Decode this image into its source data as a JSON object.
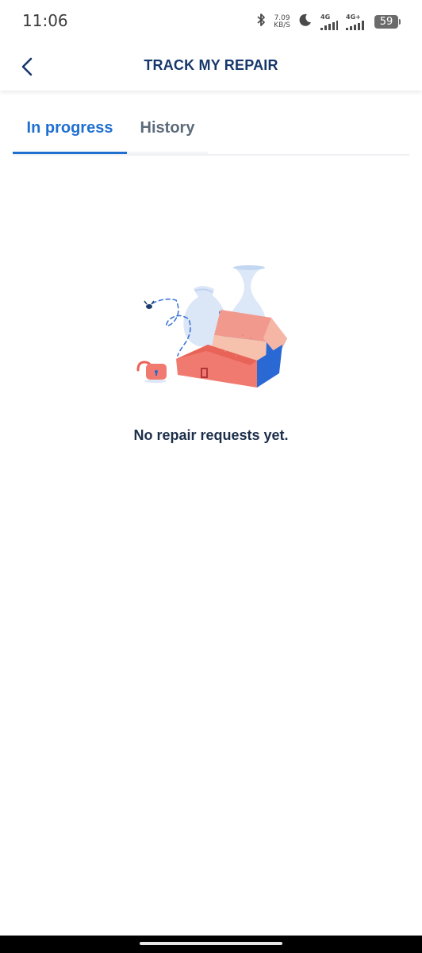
{
  "status_bar": {
    "time": "11:06",
    "net_speed_value": "7.09",
    "net_speed_unit": "KB/S",
    "sim1_label": "4G",
    "sim2_label": "4G+",
    "battery": "59",
    "icons": [
      "bluetooth-icon",
      "moon-icon",
      "signal-icon",
      "signal-icon",
      "battery-icon"
    ]
  },
  "app_bar": {
    "title": "TRACK MY REPAIR",
    "back_icon": "chevron-left-icon"
  },
  "tabs": [
    {
      "label": "In progress",
      "active": true
    },
    {
      "label": "History",
      "active": false
    }
  ],
  "empty_state": {
    "illustration": "open-box-illustration",
    "message": "No repair requests yet."
  },
  "colors": {
    "primary": "#1f6fd1",
    "title": "#17376b",
    "inactive_tab": "#5c6b7a",
    "message": "#1c2f4a",
    "box_salmon": "#f07a70",
    "box_blue": "#2a6bd6",
    "vase_light_blue": "#d8e5f7"
  }
}
